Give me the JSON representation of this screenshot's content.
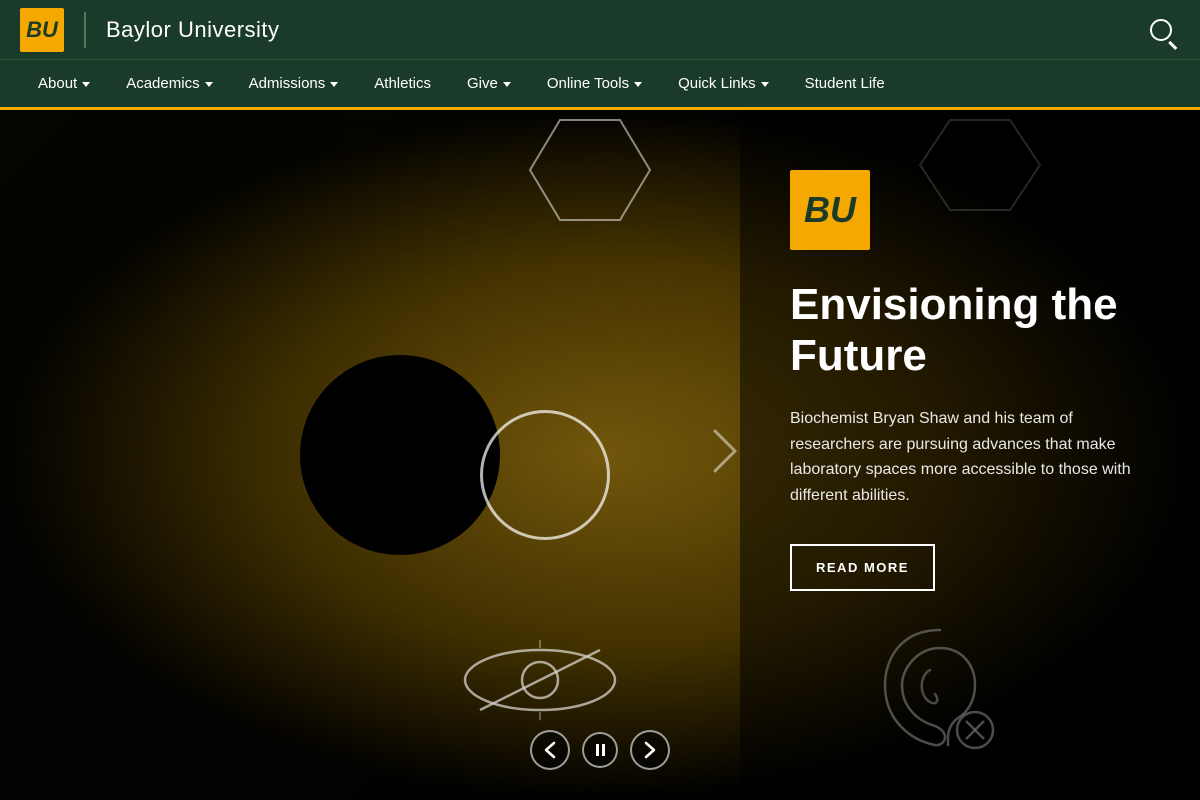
{
  "header": {
    "logo_initials": "BU",
    "university_name": "Baylor University",
    "search_label": "Search"
  },
  "nav": {
    "items": [
      {
        "label": "About",
        "has_dropdown": true
      },
      {
        "label": "Academics",
        "has_dropdown": true
      },
      {
        "label": "Admissions",
        "has_dropdown": true
      },
      {
        "label": "Athletics",
        "has_dropdown": false
      },
      {
        "label": "Give",
        "has_dropdown": true
      },
      {
        "label": "Online Tools",
        "has_dropdown": true
      },
      {
        "label": "Quick Links",
        "has_dropdown": true
      },
      {
        "label": "Student Life",
        "has_dropdown": false
      }
    ]
  },
  "hero": {
    "badge_initials": "BU",
    "title": "Envisioning the Future",
    "description": "Biochemist Bryan Shaw and his team of researchers are pursuing advances that make laboratory spaces more accessible to those with different abilities.",
    "read_more_label": "READ MORE",
    "prev_label": "Previous slide",
    "pause_label": "Pause slideshow",
    "next_label": "Next slide"
  },
  "colors": {
    "green_dark": "#1a3a2a",
    "gold": "#f5a800",
    "white": "#ffffff"
  }
}
